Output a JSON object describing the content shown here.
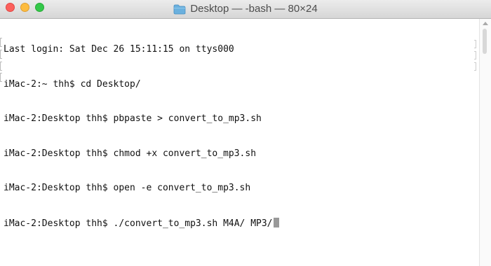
{
  "window": {
    "title": "Desktop — -bash — 80×24",
    "title_icon": "folder-icon",
    "traffic_lights": {
      "close": "#fc605c",
      "minimize": "#fdbc40",
      "maximize": "#34c84a"
    }
  },
  "terminal": {
    "lines": [
      "Last login: Sat Dec 26 15:11:15 on ttys000",
      "iMac-2:~ thh$ cd Desktop/",
      "iMac-2:Desktop thh$ pbpaste > convert_to_mp3.sh",
      "iMac-2:Desktop thh$ chmod +x convert_to_mp3.sh",
      "iMac-2:Desktop thh$ open -e convert_to_mp3.sh",
      "iMac-2:Desktop thh$ ./convert_to_mp3.sh M4A/ MP3/"
    ],
    "cursor": "block"
  }
}
